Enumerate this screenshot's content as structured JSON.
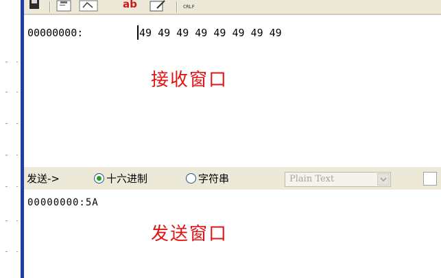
{
  "toolbar": {
    "icons": [
      "save-icon",
      "open-file-icon",
      "image-icon",
      "font-color-icon",
      "edit-icon",
      "crlf-icon"
    ],
    "ab_label": "ab",
    "crlf_label": "CRLF"
  },
  "receive": {
    "address": "00000000:",
    "bytes": "49 49 49 49 49 49 49 49",
    "caption": "接收窗口"
  },
  "options": {
    "send_label": "发送->",
    "hex_label": "十六进制",
    "hex_selected": true,
    "string_label": "字符串",
    "string_selected": false,
    "format_value": "Plain Text",
    "checkbox_checked": false
  },
  "send": {
    "content": "00000000:5A",
    "caption": "发送窗口"
  },
  "colors": {
    "accent_red": "#e01414",
    "blue_bar": "#1f3fa8",
    "panel_bg": "#ece9d8"
  }
}
